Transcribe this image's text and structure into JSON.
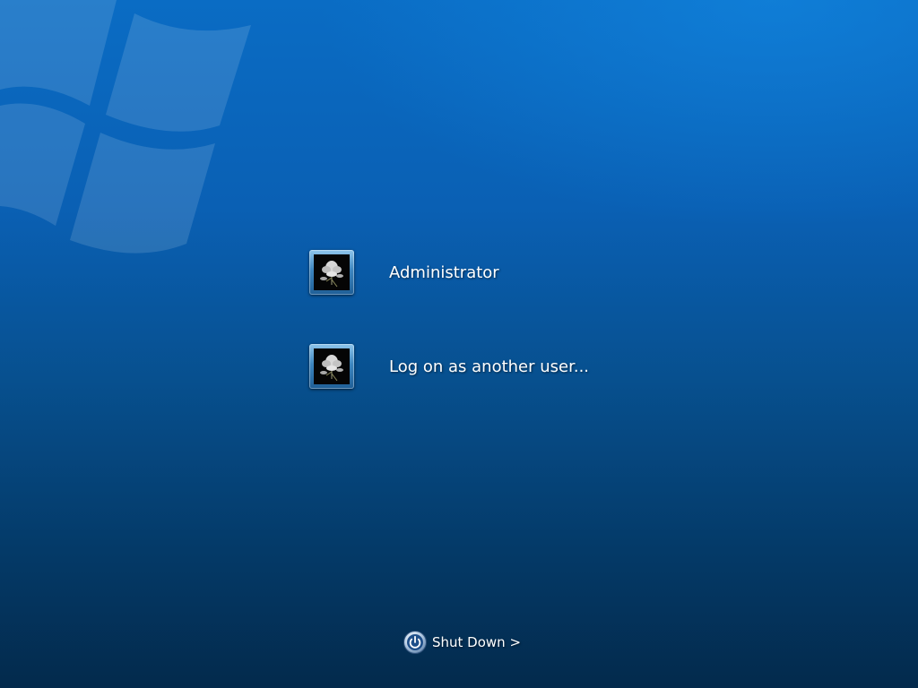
{
  "screen": {
    "type": "logon",
    "background_color_top": "#0a6cc4",
    "background_color_bottom": "#032a4c"
  },
  "users": [
    {
      "name": "Administrator",
      "avatar_icon": "flower-avatar-icon"
    },
    {
      "name": "Log on as another user...",
      "avatar_icon": "flower-avatar-icon"
    }
  ],
  "shutdown": {
    "label": "Shut Down >",
    "icon": "power-icon"
  }
}
